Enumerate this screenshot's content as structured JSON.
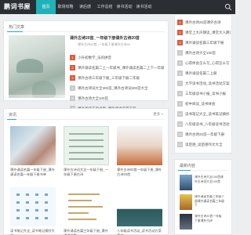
{
  "site": {
    "logo": "鹏词书屋"
  },
  "nav": {
    "items": [
      {
        "label": "首页",
        "active": true
      },
      {
        "label": "职场攻略",
        "active": false
      },
      {
        "label": "读后感",
        "active": false
      },
      {
        "label": "工作总结",
        "active": false
      },
      {
        "label": "读书活动",
        "active": false
      },
      {
        "label": "读书活动",
        "active": false
      }
    ],
    "accent": "#20b2b8"
  },
  "hot": {
    "title": "热门文章",
    "lead_title": "课外古诗20首_一年级下册课外古诗20首",
    "lead_sub": "课外古诗20首_一年级下册课外古诗20",
    "items": [
      {
        "num": "1",
        "text": "小升初数学_法的拼音"
      },
      {
        "num": "2",
        "text": "课外诵读名篇二上一年级书_课外诵读名篇二上下一年级"
      },
      {
        "num": "3",
        "text": "课外古诗三年级下册_三年级下册二年级"
      },
      {
        "num": "4",
        "text": "课外古诗词大全300首_课外古诗词300首大全"
      },
      {
        "num": "5",
        "text": "课外古诗大全100首"
      },
      {
        "num": "6",
        "text": "课外阅读下册书单_课外诵读名篇下册"
      }
    ]
  },
  "sidebar": {
    "items": [
      {
        "num": "1",
        "text": "课外古诗20首课外古诗"
      },
      {
        "num": "2",
        "text": "课堂上大声朗读_课堂大人朗读"
      },
      {
        "num": "3",
        "text": "课外诵读名篇三年级下册"
      },
      {
        "num": "4",
        "text": "课外古诗大全100首"
      },
      {
        "num": "5",
        "text": "心得体会怎么写_心得怎么写"
      },
      {
        "num": "6",
        "text": "课外诵读名篇二上册"
      },
      {
        "num": "7",
        "text": "大学读书活动_读书活动方案"
      },
      {
        "num": "8",
        "text": "三年级读书小报_读书小报"
      },
      {
        "num": "9",
        "text": "初中阅读_读书体会"
      },
      {
        "num": "10",
        "text": "读书笔记大全_读书笔记摘抄"
      },
      {
        "num": "11",
        "text": "八年级读书_八年级读书活动"
      },
      {
        "num": "12",
        "text": "课外古诗20首一年级下册"
      },
      {
        "num": "13",
        "text": "读后感_读后感作文大全"
      }
    ]
  },
  "articles": {
    "title": "资讯",
    "more": "更多 »",
    "items": [
      {
        "title": "课外诵读名篇一年级下册_课外诵读名篇一年级下册书单",
        "meta": "☆ 文章阅读"
      },
      {
        "title": "课外古诗词大全一年级下册_一年级下册古诗",
        "meta": "☆ 文章阅读"
      },
      {
        "title": "课外古诗20首一年级下册_课外古诗20首",
        "meta": "☆ 文章阅读"
      },
      {
        "title": "读书笔记大全_读书笔记摘抄大全",
        "meta": ""
      },
      {
        "title": "课外诵读名篇三年级下册_课外诵读名篇",
        "meta": ""
      },
      {
        "title": "八年级读书活动_读书活动方案范文",
        "meta": ""
      }
    ]
  },
  "latest": {
    "title": "最新内容",
    "items": [
      {
        "text": "课外古诗大全100首课外古诗词大全100首"
      },
      {
        "text": "课外诵读名篇三年级下册课外诵读名篇三年级下"
      },
      {
        "text": "课外古诗20首一年级下册课外古诗"
      }
    ]
  }
}
